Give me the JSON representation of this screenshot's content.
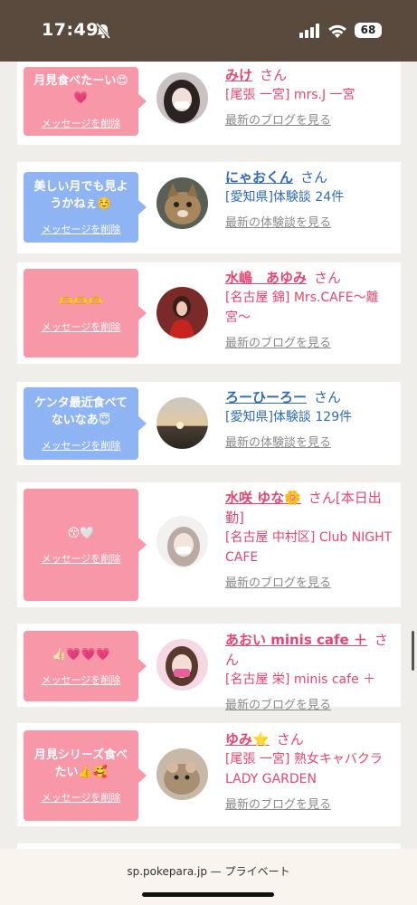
{
  "status": {
    "time": "17:49",
    "battery": "68"
  },
  "cards": [
    {
      "message": "月見食べたーい😍💗",
      "delete": "メッセージを削除",
      "name": "みけ",
      "san": "さん",
      "info": "[尾張 一宮] mrs.J 一宮",
      "latest": "最新のブログを見る",
      "bubble": "pink"
    },
    {
      "message": "美しい月でも見ようかねぇ☺️",
      "delete": "メッセージを削除",
      "name": "にゃおくん",
      "san": "さん",
      "info": "[愛知県]体験談 24件",
      "latest": "最新の体験談を見る",
      "bubble": "blue"
    },
    {
      "message": "🫶🫶🫶",
      "delete": "メッセージを削除",
      "name": "水嶋　あゆみ",
      "san": "さん",
      "info": "[名古屋 錦] Mrs.CAFE〜離宮〜",
      "latest": "最新のブログを見る",
      "bubble": "pink"
    },
    {
      "message": "ケンタ最近食べてないなあ😇",
      "delete": "メッセージを削除",
      "name": "ろーひーろー",
      "san": "さん",
      "info": "[愛知県]体験談 129件",
      "latest": "最新の体験談を見る",
      "bubble": "blue"
    },
    {
      "message": "😚🤍",
      "delete": "メッセージを削除",
      "name": "水咲 ゆな🌼",
      "san": "さん[本日出勤]",
      "info": "[名古屋 中村区] Club NIGHT CAFE",
      "latest": "最新のブログを見る",
      "bubble": "pink"
    },
    {
      "message": "👍🏻💗💗💗",
      "delete": "メッセージを削除",
      "name": "あおい minis cafe ＋",
      "san": "さん",
      "info": "[名古屋 栄] minis cafe ＋",
      "latest": "最新のブログを見る",
      "bubble": "pink"
    },
    {
      "message": "月見シリーズ食べたい👍🥰",
      "delete": "メッセージを削除",
      "name": "ゆみ⭐️",
      "san": "さん",
      "info": "[尾張 一宮] 熟女キャバクラ LADY GARDEN",
      "latest": "最新のブログを見る",
      "bubble": "pink"
    }
  ],
  "bottom": {
    "url": "sp.pokepara.jp",
    "separator": "—",
    "mode": "プライベート"
  }
}
